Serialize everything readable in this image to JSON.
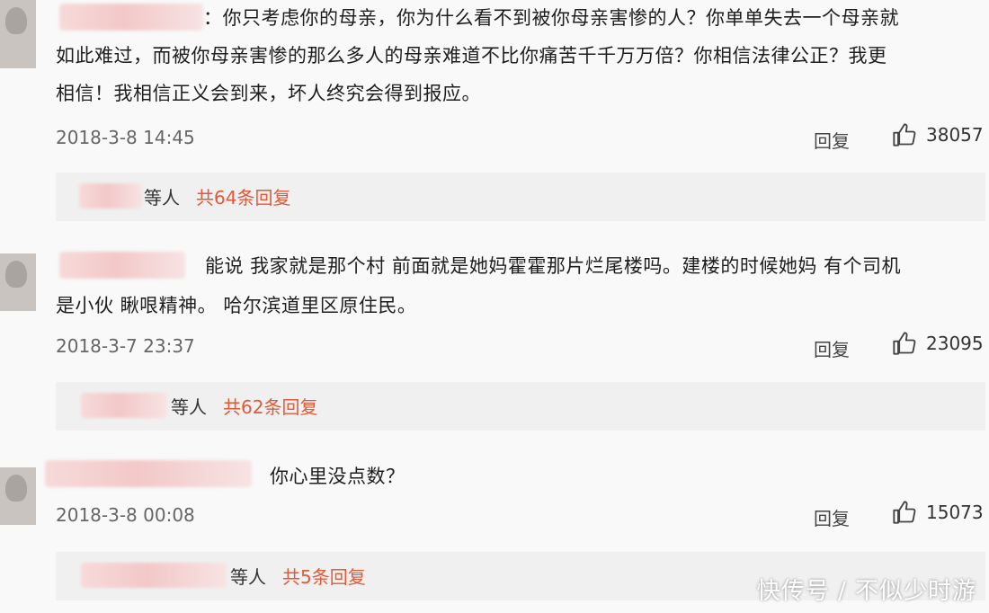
{
  "comments": [
    {
      "text": "：你只考虑你的母亲，你为什么看不到被你母亲害惨的人？你单单失去一个母亲就如此难过，而被你母亲害惨的那么多人的母亲难道不比你痛苦千千万万倍？你相信法律公正？我更相信！我相信正义会到来，坏人终究会得到报应。",
      "line1": "：你只考虑你的母亲，你为什么看不到被你母亲害惨的人？你单单失去一个母亲就",
      "line2": "如此难过，而被你母亲害惨的那么多人的母亲难道不比你痛苦千千万万倍？你相信法律公正？我更",
      "line3": "相信！我相信正义会到来，坏人终究会得到报应。",
      "time": "2018-3-8 14:45",
      "reply_label": "回复",
      "likes": "38057",
      "sub": {
        "deng": "等人",
        "more": "共64条回复"
      }
    },
    {
      "line1": "能说 我家就是那个村 前面就是她妈霍霍那片烂尾楼吗。建楼的时候她妈 有个司机",
      "line2": "是小伙 瞅哏精神。 哈尔滨道里区原住民。",
      "time": "2018-3-7 23:37",
      "reply_label": "回复",
      "likes": "23095",
      "sub": {
        "deng": "等人",
        "more": "共62条回复"
      }
    },
    {
      "line1": "你心里没点数？",
      "time": "2018-3-8 00:08",
      "reply_label": "回复",
      "likes": "15073",
      "sub": {
        "deng": "等人",
        "more": "共5条回复"
      }
    }
  ],
  "watermark": "快传号 / 不似少时游",
  "colors": {
    "accent": "#e05a3a",
    "reply_bg": "#f0f0f0",
    "page_bg": "#f9f9f9"
  },
  "icons": {
    "like": "thumbs-up-icon"
  }
}
